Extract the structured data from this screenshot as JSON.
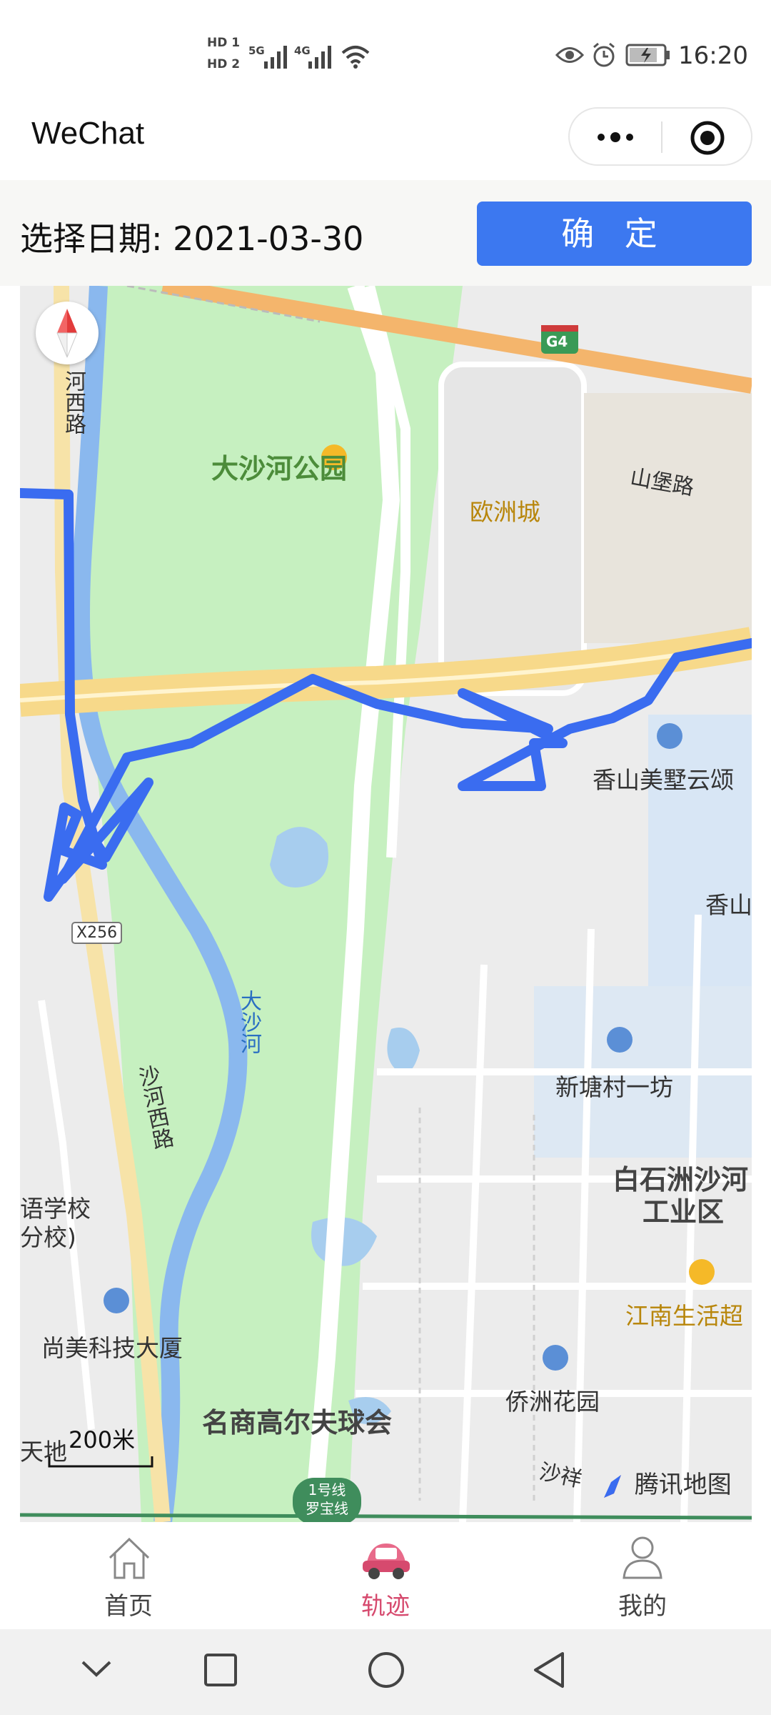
{
  "status_bar": {
    "sim1": "HD 1",
    "sim2": "HD 2",
    "net1": "5G",
    "net2": "4G",
    "time": "16:20",
    "icons": [
      "eye-icon",
      "alarm-icon",
      "battery-charging-icon"
    ]
  },
  "title_bar": {
    "title": "WeChat",
    "icons": [
      "more-icon",
      "close-miniprogram-icon"
    ]
  },
  "date_bar": {
    "label": "选择日期: 2021-03-30",
    "confirm": "确 定"
  },
  "map": {
    "labels": {
      "park": "大沙河公园",
      "mall": "欧洲城",
      "road_shanbao": "山堡路",
      "road_hexi": "河西路",
      "expressway": "G4",
      "xiangshan_villa": "香山美墅云颂",
      "xiangshan": "香山",
      "x256": "X256",
      "river": "大沙河",
      "road_shahexi": "沙河西路",
      "xintang": "新塘村一坊",
      "baishizhou_1": "白石洲沙河",
      "baishizhou_2": "工业区",
      "school_1": "语学校",
      "school_2": "分校)",
      "jiangnan": "江南生活超",
      "shangmei": "尚美科技大厦",
      "qiaozhou": "侨洲花园",
      "golf": "名商高尔夫球会",
      "tiandi": "天地",
      "shaxiang": "沙祥",
      "metro_1": "1号线",
      "metro_2": "罗宝线"
    },
    "scale": "200米",
    "watermark": "腾讯地图",
    "route_color": "#3a6cf0"
  },
  "tabs": [
    {
      "label": "首页",
      "icon": "home-icon",
      "active": false
    },
    {
      "label": "轨迹",
      "icon": "car-icon",
      "active": true
    },
    {
      "label": "我的",
      "icon": "user-icon",
      "active": false
    }
  ],
  "colors": {
    "accent": "#3c78f0",
    "active_tab": "#d64a6e"
  }
}
